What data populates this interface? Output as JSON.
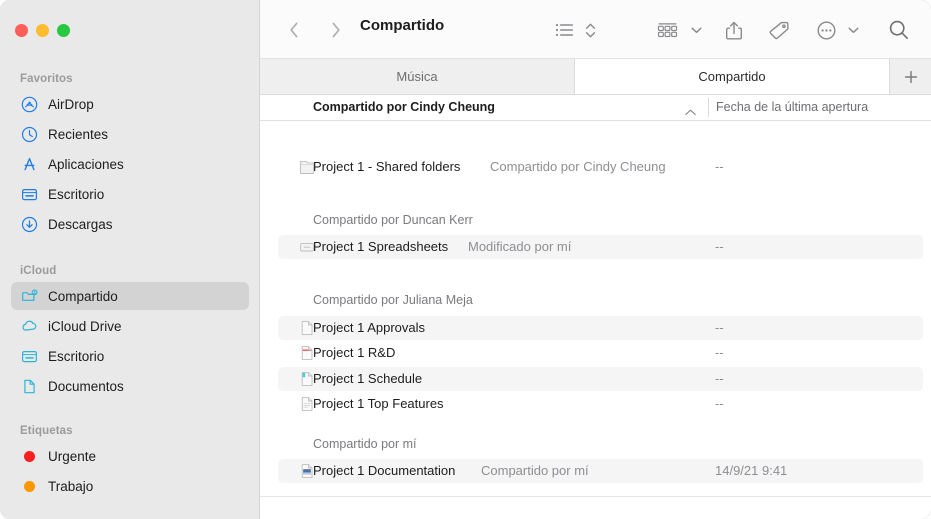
{
  "window": {
    "title": "Compartido",
    "traffic_lights": [
      {
        "name": "close",
        "color": "#ff5f57"
      },
      {
        "name": "minimize",
        "color": "#febc2e"
      },
      {
        "name": "zoom",
        "color": "#28c840"
      }
    ]
  },
  "toolbar": {
    "back_icon": "chevron-left-icon",
    "forward_icon": "chevron-right-icon",
    "title": "Compartido",
    "view_icon": "list-view-icon",
    "sort_icon": "sort-updown-icon",
    "group_icon": "group-by-icon",
    "group_chevron_icon": "chevron-down-icon",
    "share_icon": "share-icon",
    "tag_icon": "tag-icon",
    "more_icon": "more-ellipsis-icon",
    "more_chevron_icon": "chevron-down-icon",
    "search_icon": "search-icon"
  },
  "tabs": {
    "items": [
      {
        "label": "Música",
        "active": false
      },
      {
        "label": "Compartido",
        "active": true
      }
    ],
    "add_label": "+"
  },
  "sidebar": {
    "sections": [
      {
        "header": "Favoritos",
        "items": [
          {
            "label": "AirDrop",
            "icon": "airdrop-icon",
            "selected": false
          },
          {
            "label": "Recientes",
            "icon": "clock-icon",
            "selected": false
          },
          {
            "label": "Aplicaciones",
            "icon": "applications-icon",
            "selected": false
          },
          {
            "label": "Escritorio",
            "icon": "desktop-icon",
            "selected": false
          },
          {
            "label": "Descargas",
            "icon": "downloads-icon",
            "selected": false
          }
        ]
      },
      {
        "header": "iCloud",
        "items": [
          {
            "label": "Compartido",
            "icon": "shared-folder-icon",
            "selected": true
          },
          {
            "label": "iCloud Drive",
            "icon": "cloud-icon",
            "selected": false
          },
          {
            "label": "Escritorio",
            "icon": "desktop-icon",
            "selected": false
          },
          {
            "label": "Documentos",
            "icon": "document-icon",
            "selected": false
          }
        ]
      },
      {
        "header": "Etiquetas",
        "items": [
          {
            "label": "Urgente",
            "icon": "tag-dot-icon",
            "color": "#fb1f1f",
            "selected": false
          },
          {
            "label": "Trabajo",
            "icon": "tag-dot-icon",
            "color": "#fb9700",
            "selected": false
          }
        ]
      }
    ]
  },
  "columns": {
    "primary": "Compartido por Cindy Cheung",
    "sort_chevron_icon": "chevron-up-icon",
    "secondary": "Fecha de la última apertura"
  },
  "filelist": {
    "groups": [
      {
        "title": "",
        "rows": [
          {
            "name": "Project 1 - Shared folders",
            "meta": "Compartido por Cindy Cheung",
            "date": "--",
            "icon": "shared-folder-file-icon",
            "striped": false
          }
        ]
      },
      {
        "title": "Compartido por Duncan Kerr",
        "rows": [
          {
            "name": "Project 1 Spreadsheets",
            "meta": "Modificado por mí",
            "date": "--",
            "icon": "spreadsheet-icon",
            "striped": true
          }
        ]
      },
      {
        "title": "Compartido por Juliana Meja",
        "rows": [
          {
            "name": "Project 1 Approvals",
            "meta": "",
            "date": "--",
            "icon": "document-plain-icon",
            "striped": true
          },
          {
            "name": "Project 1 R&D",
            "meta": "",
            "date": "--",
            "icon": "document-red-icon",
            "striped": false
          },
          {
            "name": "Project 1 Schedule",
            "meta": "",
            "date": "--",
            "icon": "document-cyan-icon",
            "striped": true
          },
          {
            "name": "Project 1 Top Features",
            "meta": "",
            "date": "--",
            "icon": "document-text-icon",
            "striped": false
          }
        ]
      },
      {
        "title": "Compartido por mí",
        "rows": [
          {
            "name": "Project 1 Documentation",
            "meta": "Compartido por mí",
            "date": "14/9/21  9:41",
            "icon": "document-image-icon",
            "striped": true
          }
        ]
      }
    ]
  },
  "colors": {
    "sidebar_bg": "#e9e9e9",
    "selection": "#d3d3d3",
    "accent_blue": "#1f7ce8",
    "accent_cyan": "#2ab5d6",
    "row_stripe": "#f5f5f5"
  }
}
